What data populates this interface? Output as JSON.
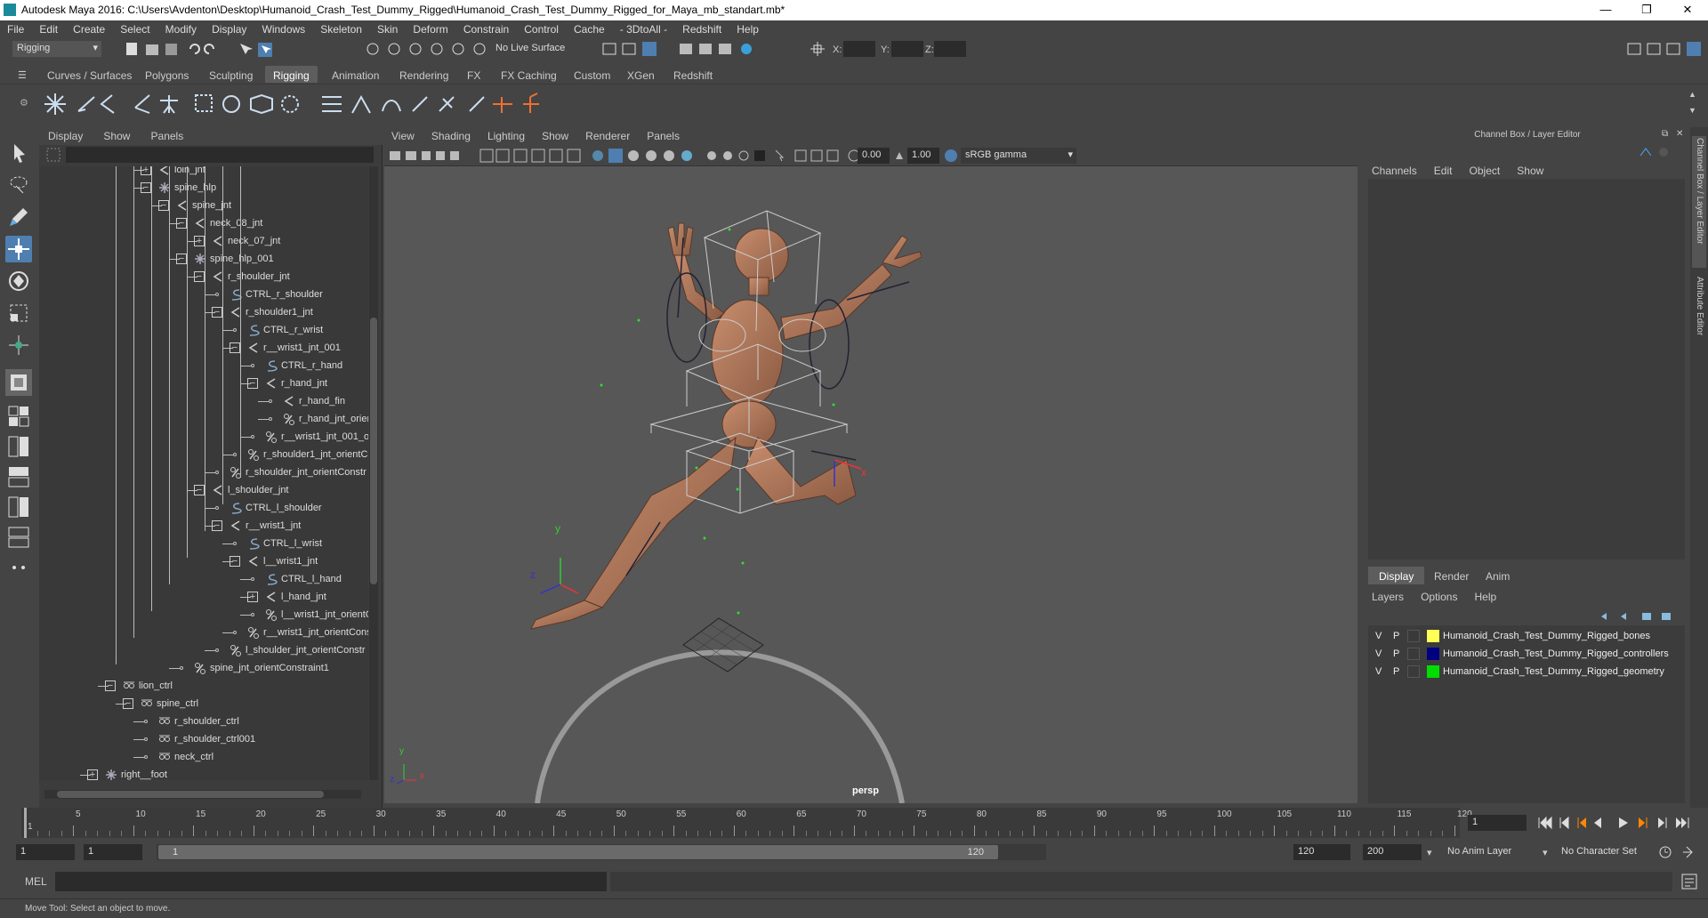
{
  "window": {
    "title": "Autodesk Maya 2016: C:\\Users\\Avdenton\\Desktop\\Humanoid_Crash_Test_Dummy_Rigged\\Humanoid_Crash_Test_Dummy_Rigged_for_Maya_mb_standart.mb*",
    "minimize": "—",
    "maximize": "❐",
    "close": "✕"
  },
  "menubar": [
    "File",
    "Edit",
    "Create",
    "Select",
    "Modify",
    "Display",
    "Windows",
    "Skeleton",
    "Skin",
    "Deform",
    "Constrain",
    "Control",
    "Cache",
    "- 3DtoAll -",
    "Redshift",
    "Help"
  ],
  "statusline": {
    "menuset": "Rigging",
    "live_surface": "No Live Surface",
    "x_label": "X:",
    "y_label": "Y:",
    "z_label": "Z:"
  },
  "shelf_tabs": [
    "Curves / Surfaces",
    "Polygons",
    "Sculpting",
    "Rigging",
    "Animation",
    "Rendering",
    "FX",
    "FX Caching",
    "Custom",
    "XGen",
    "Redshift"
  ],
  "active_shelf_tab": "Rigging",
  "outliner": {
    "menu": [
      "Display",
      "Show",
      "Panels"
    ],
    "items": [
      {
        "label": "loin_jnt",
        "icon": "joint-icon",
        "exp": "+"
      },
      {
        "label": "spine_hlp",
        "icon": "locator-icon",
        "exp": "−"
      },
      {
        "label": "spine_jnt",
        "icon": "joint-icon",
        "exp": "−"
      },
      {
        "label": "neck_08_jnt",
        "icon": "joint-icon",
        "exp": "−"
      },
      {
        "label": "neck_07_jnt",
        "icon": "joint-icon",
        "exp": "+"
      },
      {
        "label": "spine_hlp_001",
        "icon": "locator-icon",
        "exp": "−"
      },
      {
        "label": "r_shoulder_jnt",
        "icon": "joint-icon",
        "exp": "−"
      },
      {
        "label": "CTRL_r_shoulder",
        "icon": "curve-icon",
        "exp": ""
      },
      {
        "label": "r_shoulder1_jnt",
        "icon": "joint-icon",
        "exp": "−"
      },
      {
        "label": "CTRL_r_wrist",
        "icon": "curve-icon",
        "exp": ""
      },
      {
        "label": "r__wrist1_jnt_001",
        "icon": "joint-icon",
        "exp": "−"
      },
      {
        "label": "CTRL_r_hand",
        "icon": "curve-icon",
        "exp": ""
      },
      {
        "label": "r_hand_jnt",
        "icon": "joint-icon",
        "exp": "−"
      },
      {
        "label": "r_hand_fin",
        "icon": "joint-icon",
        "exp": ""
      },
      {
        "label": "r_hand_jnt_orien",
        "icon": "constraint-icon",
        "exp": ""
      },
      {
        "label": "r__wrist1_jnt_001_or",
        "icon": "constraint-icon",
        "exp": ""
      },
      {
        "label": "r_shoulder1_jnt_orientC",
        "icon": "constraint-icon",
        "exp": ""
      },
      {
        "label": "r_shoulder_jnt_orientConstr",
        "icon": "constraint-icon",
        "exp": ""
      },
      {
        "label": "l_shoulder_jnt",
        "icon": "joint-icon",
        "exp": "−"
      },
      {
        "label": "CTRL_l_shoulder",
        "icon": "curve-icon",
        "exp": ""
      },
      {
        "label": "r__wrist1_jnt",
        "icon": "joint-icon",
        "exp": "−"
      },
      {
        "label": "CTRL_l_wrist",
        "icon": "curve-icon",
        "exp": ""
      },
      {
        "label": "l__wrist1_jnt",
        "icon": "joint-icon",
        "exp": "−"
      },
      {
        "label": "CTRL_l_hand",
        "icon": "curve-icon",
        "exp": ""
      },
      {
        "label": "l_hand_jnt",
        "icon": "joint-icon",
        "exp": "+"
      },
      {
        "label": "l__wrist1_jnt_orientC",
        "icon": "constraint-icon",
        "exp": ""
      },
      {
        "label": "r__wrist1_jnt_orientCons",
        "icon": "constraint-icon",
        "exp": ""
      },
      {
        "label": "l_shoulder_jnt_orientConstr",
        "icon": "constraint-icon",
        "exp": ""
      },
      {
        "label": "spine_jnt_orientConstraint1",
        "icon": "constraint-icon",
        "exp": ""
      },
      {
        "label": "lion_ctrl",
        "icon": "transform-icon",
        "exp": "−"
      },
      {
        "label": "spine_ctrl",
        "icon": "transform-icon",
        "exp": "−"
      },
      {
        "label": "r_shoulder_ctrl",
        "icon": "transform-icon",
        "exp": ""
      },
      {
        "label": "r_shoulder_ctrl001",
        "icon": "transform-icon",
        "exp": ""
      },
      {
        "label": "neck_ctrl",
        "icon": "transform-icon",
        "exp": ""
      },
      {
        "label": "right__foot",
        "icon": "locator-icon",
        "exp": "+"
      }
    ]
  },
  "viewport": {
    "menu": [
      "View",
      "Shading",
      "Lighting",
      "Show",
      "Renderer",
      "Panels"
    ],
    "exposure": "0.00",
    "gamma": "1.00",
    "color_space": "sRGB gamma",
    "camera_label": "persp",
    "axis_x": "x",
    "axis_y": "y",
    "axis_z": "z"
  },
  "channel_box": {
    "title": "Channel Box / Layer Editor",
    "menu": [
      "Channels",
      "Edit",
      "Object",
      "Show"
    ],
    "layer_tabs": [
      "Display",
      "Render",
      "Anim"
    ],
    "layer_menu": [
      "Layers",
      "Options",
      "Help"
    ],
    "layers": [
      {
        "v": "V",
        "p": "P",
        "color": "#ffff55",
        "name": "Humanoid_Crash_Test_Dummy_Rigged_bones"
      },
      {
        "v": "V",
        "p": "P",
        "color": "#000080",
        "name": "Humanoid_Crash_Test_Dummy_Rigged_controllers"
      },
      {
        "v": "V",
        "p": "P",
        "color": "#00dd00",
        "name": "Humanoid_Crash_Test_Dummy_Rigged_geometry"
      }
    ],
    "side_tab_1": "Channel Box / Layer Editor",
    "side_tab_2": "Attribute Editor"
  },
  "timeline": {
    "ticks": [
      "1",
      "5",
      "10",
      "15",
      "20",
      "25",
      "30",
      "35",
      "40",
      "45",
      "50",
      "55",
      "60",
      "65",
      "70",
      "75",
      "80",
      "85",
      "90",
      "95",
      "100",
      "105",
      "110",
      "115",
      "120"
    ],
    "current_frame": "1"
  },
  "range": {
    "start": "1",
    "playback_start": "1",
    "slider_start": "1",
    "slider_end": "120",
    "playback_end": "120",
    "end": "200",
    "anim_layer": "No Anim Layer",
    "character_set": "No Character Set"
  },
  "cmdline": {
    "label": "MEL"
  },
  "help_line": "Move Tool: Select an object to move."
}
